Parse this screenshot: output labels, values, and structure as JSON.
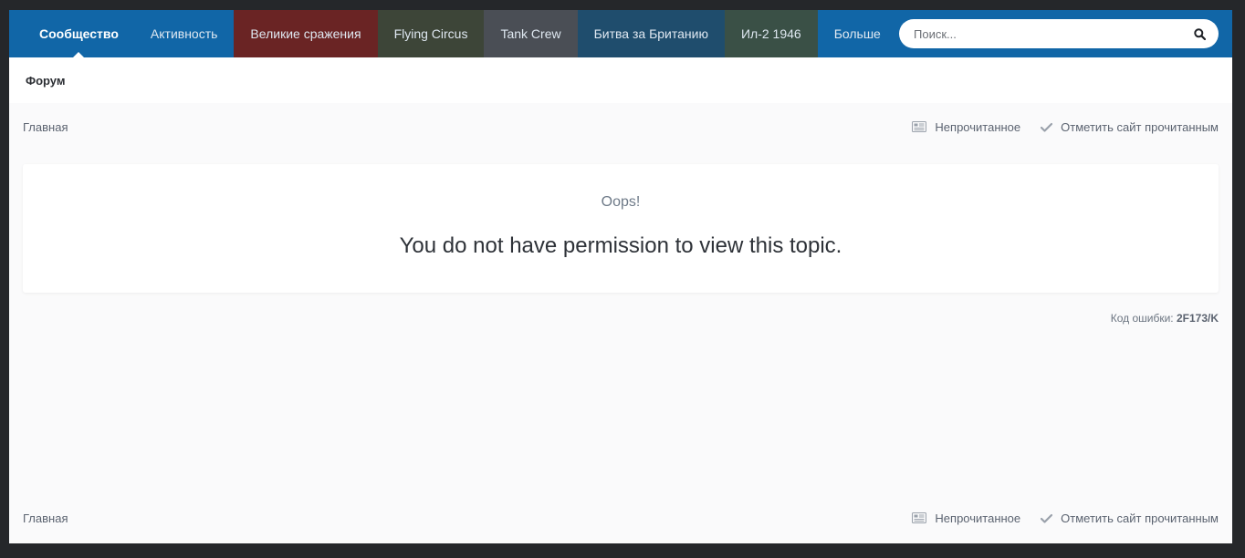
{
  "nav": {
    "items": [
      {
        "label": "Сообщество"
      },
      {
        "label": "Активность"
      },
      {
        "label": "Великие сражения"
      },
      {
        "label": "Flying Circus"
      },
      {
        "label": "Tank Crew"
      },
      {
        "label": "Битва за Британию"
      },
      {
        "label": "Ил-2 1946"
      },
      {
        "label": "Больше"
      }
    ],
    "search_placeholder": "Поиск...",
    "colors": {
      "primary": "#1166a7",
      "great_battles": "#6a2424",
      "flying_circus": "#3d4538",
      "tank_crew": "#4a4e55",
      "battle_of_britain": "#1f4d6d",
      "il2_1946": "#3a5046"
    }
  },
  "subnav": {
    "label": "Форум"
  },
  "breadcrumb": {
    "home": "Главная",
    "unread": "Непрочитанное",
    "mark_read": "Отметить сайт прочитанным"
  },
  "error": {
    "oops": "Oops!",
    "message": "You do not have permission to view this topic.",
    "code_label": "Код ошибки:",
    "code": "2F173/K"
  }
}
